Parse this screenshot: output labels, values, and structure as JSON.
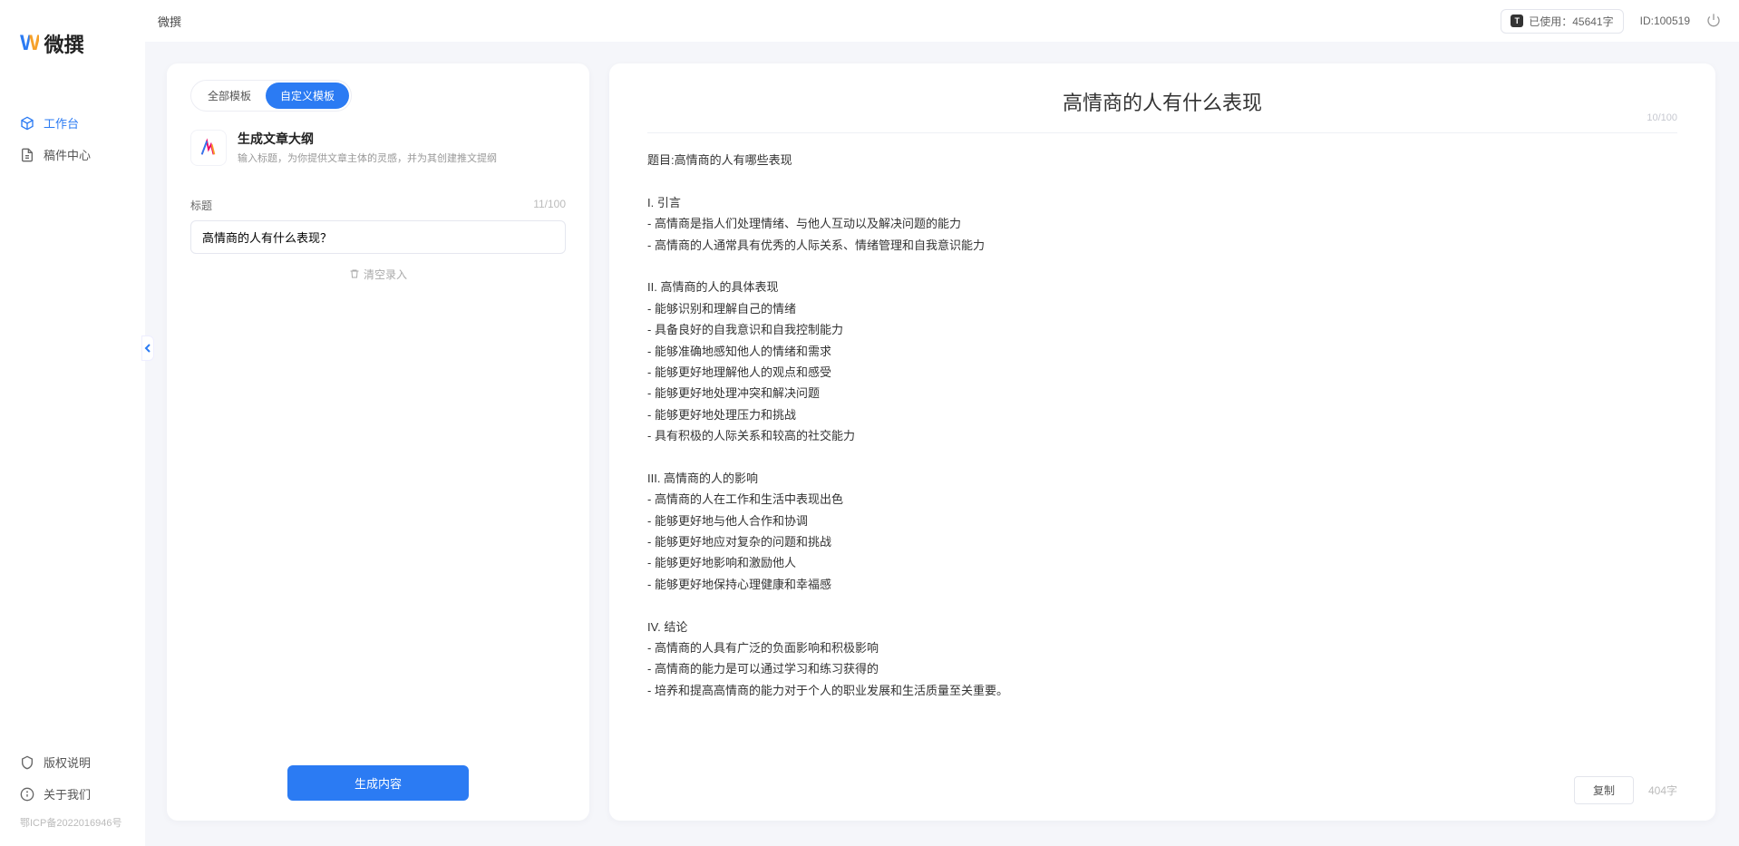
{
  "brand": {
    "logo_text": "微撰"
  },
  "sidebar": {
    "nav": [
      {
        "label": "工作台",
        "icon": "cube-icon",
        "active": true
      },
      {
        "label": "稿件中心",
        "icon": "document-icon",
        "active": false
      }
    ],
    "bottom": [
      {
        "label": "版权说明",
        "icon": "shield-icon"
      },
      {
        "label": "关于我们",
        "icon": "info-icon"
      }
    ],
    "icp": "鄂ICP备2022016946号"
  },
  "topbar": {
    "breadcrumb": "微撰",
    "usage_pill_label": "已使用：45641字",
    "id_label": "ID:100519"
  },
  "left_panel": {
    "tabs": [
      {
        "label": "全部模板",
        "active": false
      },
      {
        "label": "自定义模板",
        "active": true
      }
    ],
    "template": {
      "title": "生成文章大纲",
      "desc": "输入标题，为你提供文章主体的灵感，并为其创建推文提纲"
    },
    "form": {
      "title_label": "标题",
      "title_counter": "11/100",
      "title_value": "高情商的人有什么表现？",
      "clear_label": "清空录入",
      "generate_label": "生成内容"
    }
  },
  "right_panel": {
    "doc_title": "高情商的人有什么表现",
    "doc_title_counter": "10/100",
    "doc_body": "题目:高情商的人有哪些表现\n\nI. 引言\n- 高情商是指人们处理情绪、与他人互动以及解决问题的能力\n- 高情商的人通常具有优秀的人际关系、情绪管理和自我意识能力\n\nII. 高情商的人的具体表现\n- 能够识别和理解自己的情绪\n- 具备良好的自我意识和自我控制能力\n- 能够准确地感知他人的情绪和需求\n- 能够更好地理解他人的观点和感受\n- 能够更好地处理冲突和解决问题\n- 能够更好地处理压力和挑战\n- 具有积极的人际关系和较高的社交能力\n\nIII. 高情商的人的影响\n- 高情商的人在工作和生活中表现出色\n- 能够更好地与他人合作和协调\n- 能够更好地应对复杂的问题和挑战\n- 能够更好地影响和激励他人\n- 能够更好地保持心理健康和幸福感\n\nIV. 结论\n- 高情商的人具有广泛的负面影响和积极影响\n- 高情商的能力是可以通过学习和练习获得的\n- 培养和提高高情商的能力对于个人的职业发展和生活质量至关重要。",
    "copy_label": "复制",
    "word_stat": "404字"
  }
}
